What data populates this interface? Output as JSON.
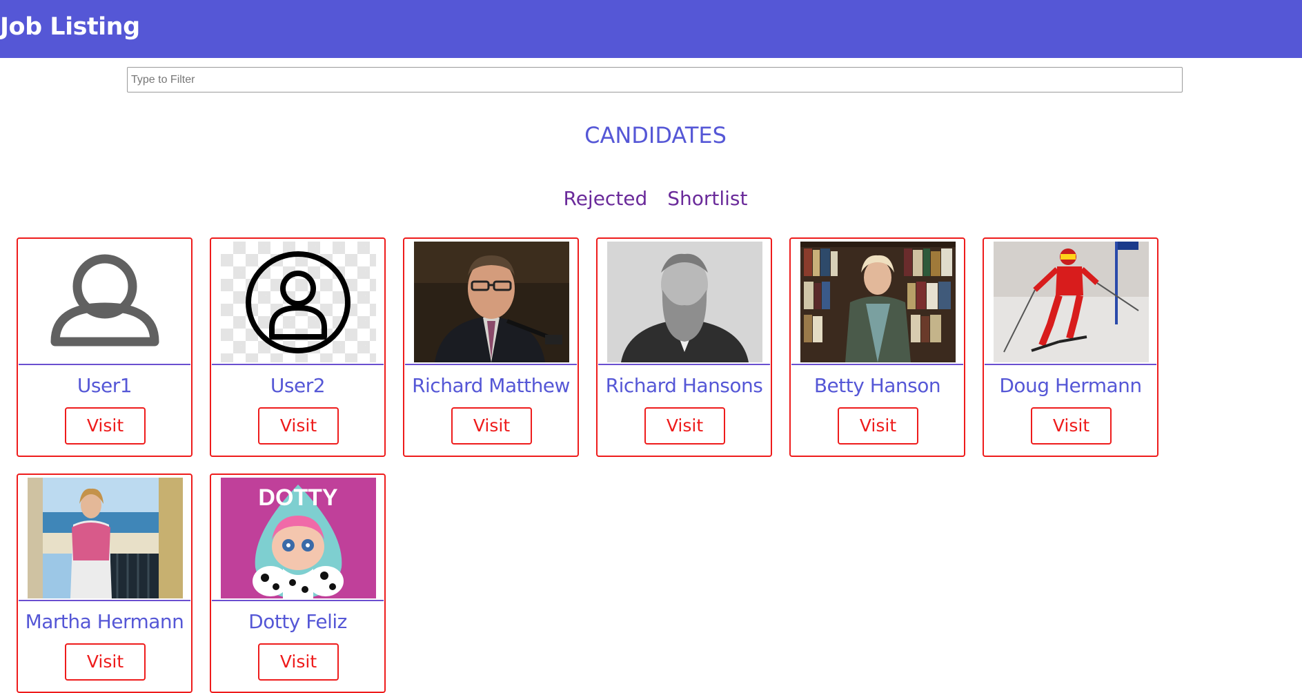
{
  "header": {
    "title": "Job Listing",
    "color": "#5557d6"
  },
  "filter": {
    "placeholder": "Type to Filter",
    "value": ""
  },
  "section": {
    "title": "CANDIDATES"
  },
  "tabs": [
    {
      "label": "Rejected"
    },
    {
      "label": "Shortlist"
    }
  ],
  "candidates": [
    {
      "name": "User1",
      "action": "Visit",
      "photo": "generic-user-icon"
    },
    {
      "name": "User2",
      "action": "Visit",
      "photo": "user-circle-icon"
    },
    {
      "name": "Richard Matthew",
      "action": "Visit",
      "photo": "man-speaking-at-microphone"
    },
    {
      "name": "Richard Hansons",
      "action": "Visit",
      "photo": "bearded-man-portrait"
    },
    {
      "name": "Betty Hanson",
      "action": "Visit",
      "photo": "woman-in-library"
    },
    {
      "name": "Doug Hermann",
      "action": "Visit",
      "photo": "skier"
    },
    {
      "name": "Martha Hermann",
      "action": "Visit",
      "photo": "woman-on-balcony"
    },
    {
      "name": "Dotty Feliz",
      "action": "Visit",
      "photo": "dotty-cartoon"
    }
  ],
  "photo_texts": {
    "dotty_logo": "DOTTY"
  },
  "colors": {
    "card_border": "#ee1b1b",
    "name_text": "#5557d6",
    "tab_text": "#6a2a9a"
  }
}
